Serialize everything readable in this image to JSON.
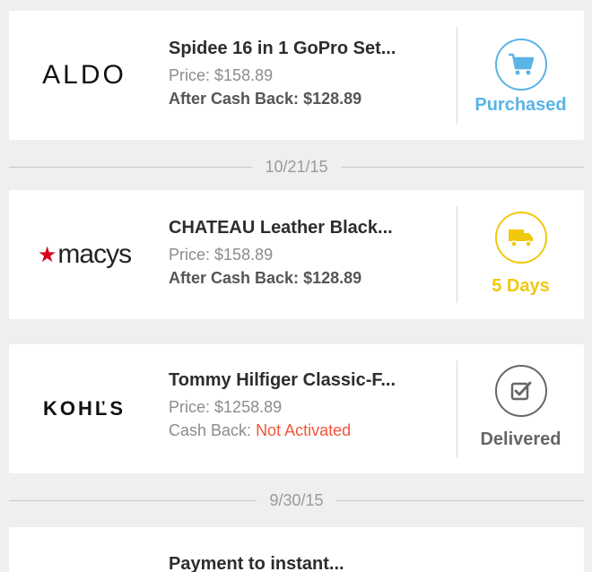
{
  "colors": {
    "purchased": "#5ab4e5",
    "shipping": "#f2c80f",
    "delivered": "#666666",
    "not_activated": "#f0553a",
    "macys_star": "#d6001c"
  },
  "orders": [
    {
      "store": "ALDO",
      "title": "Spidee 16 in 1 GoPro Set...",
      "price_label": "Price:",
      "price": "$158.89",
      "cashback_label": "After Cash Back:",
      "cashback": "$128.89",
      "status_icon": "cart-icon",
      "status_label": "Purchased"
    },
    {
      "store_star": "★",
      "store": "macys",
      "title": "CHATEAU Leather Black...",
      "price_label": "Price:",
      "price": "$158.89",
      "cashback_label": "After Cash Back:",
      "cashback": "$128.89",
      "status_icon": "truck-icon",
      "status_label": "5 Days"
    },
    {
      "store": "KOHĽS",
      "title": "Tommy Hilfiger Classic-F...",
      "price_label": "Price:",
      "price": "$1258.89",
      "cashback_label": "Cash Back:",
      "cashback": "Not Activated",
      "status_icon": "checkbox-icon",
      "status_label": "Delivered"
    },
    {
      "title": "Payment to instant..."
    }
  ],
  "dates": [
    "10/21/15",
    "9/30/15"
  ]
}
